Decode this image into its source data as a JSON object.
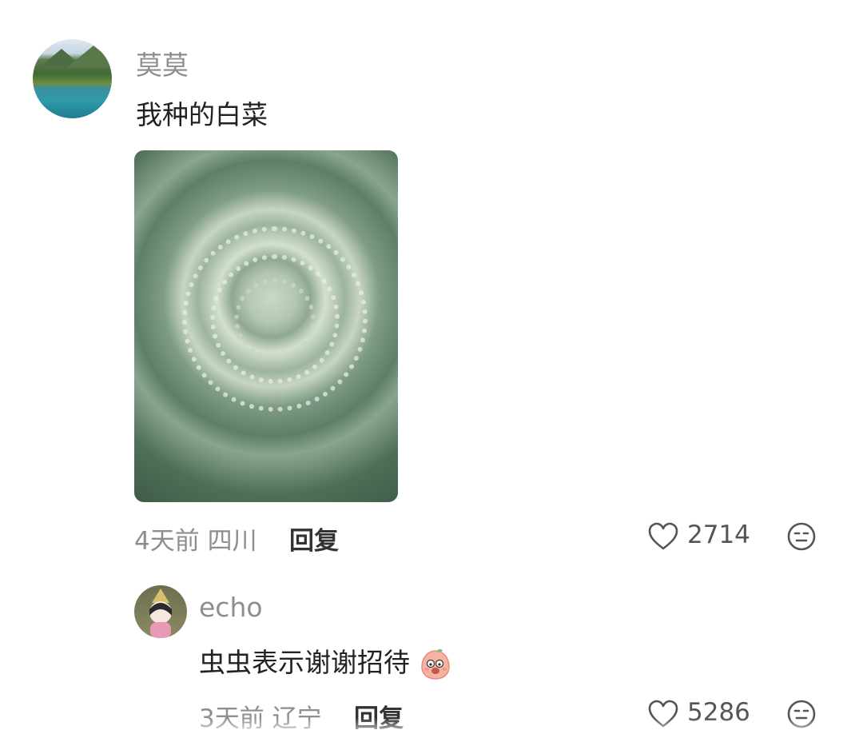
{
  "comment": {
    "username": "莫莫",
    "text": "我种的白菜",
    "meta": "4天前 四川",
    "reply_label": "回复",
    "likes": "2714",
    "reaction_icon": "neutral-face-icon",
    "like_icon": "heart-icon"
  },
  "reply_comment": {
    "username": "echo",
    "text": "虫虫表示谢谢招待",
    "emoji": "embarrassed-peach-emoji",
    "meta": "3天前 辽宁",
    "reply_label": "回复",
    "likes": "5286",
    "reaction_icon": "neutral-face-icon",
    "like_icon": "heart-icon"
  },
  "colors": {
    "muted_text": "#8e8e8e",
    "body_text": "#222222"
  }
}
